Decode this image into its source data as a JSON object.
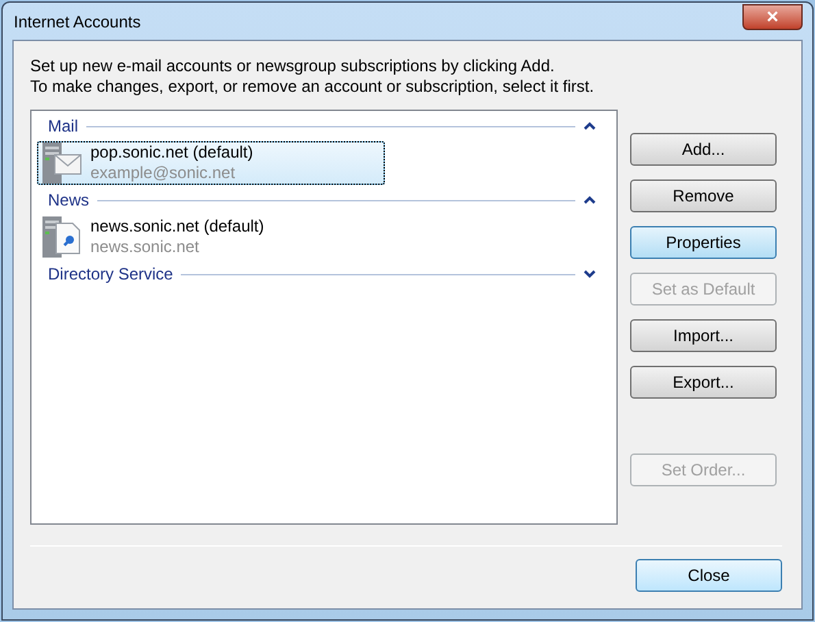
{
  "window": {
    "title": "Internet Accounts",
    "close_label": "×"
  },
  "instructions": [
    "Set up new e-mail accounts or newsgroup subscriptions by clicking Add.",
    "To make changes, export, or remove an account or subscription, select it first."
  ],
  "groups": [
    {
      "label": "Mail",
      "expanded": true,
      "accounts": [
        {
          "kind": "mail",
          "name": "pop.sonic.net (default)",
          "detail": "example@sonic.net",
          "selected": true
        }
      ]
    },
    {
      "label": "News",
      "expanded": true,
      "accounts": [
        {
          "kind": "news",
          "name": "news.sonic.net (default)",
          "detail": "news.sonic.net",
          "selected": false
        }
      ]
    },
    {
      "label": "Directory Service",
      "expanded": false
    }
  ],
  "buttons": [
    {
      "label": "Add...",
      "disabled": false,
      "focused": false
    },
    {
      "label": "Remove",
      "disabled": false,
      "focused": false
    },
    {
      "label": "Properties",
      "disabled": false,
      "focused": true
    },
    {
      "label": "Set as Default",
      "disabled": true,
      "focused": false
    },
    {
      "label": "Import...",
      "disabled": false,
      "focused": false
    },
    {
      "label": "Export...",
      "disabled": false,
      "focused": false
    },
    {
      "label": "Set Order...",
      "disabled": true,
      "focused": false
    }
  ],
  "close_button": {
    "label": "Close"
  }
}
